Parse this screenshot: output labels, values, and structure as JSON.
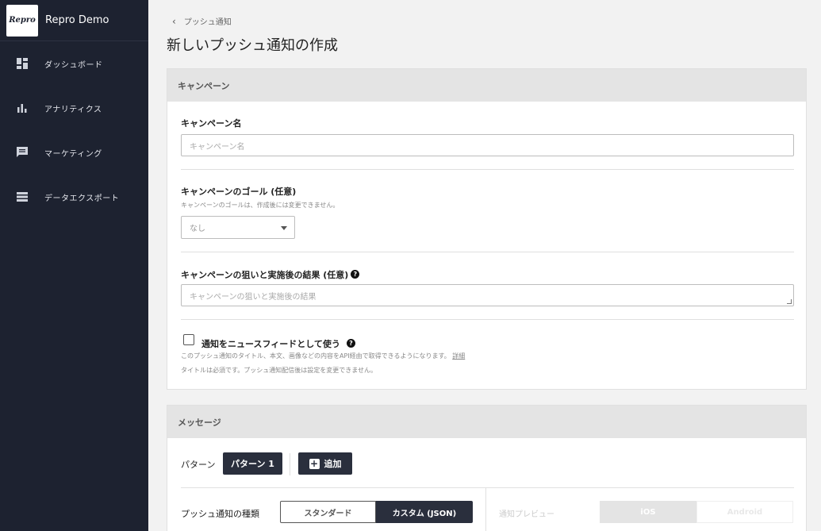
{
  "app": {
    "logo_text": "Repro",
    "name": "Repro Demo"
  },
  "sidebar": {
    "items": [
      {
        "label": "ダッシュボード",
        "icon": "dashboard-icon"
      },
      {
        "label": "アナリティクス",
        "icon": "bar-chart-icon"
      },
      {
        "label": "マーケティング",
        "icon": "message-icon"
      },
      {
        "label": "データエクスポート",
        "icon": "list-icon"
      }
    ]
  },
  "breadcrumb": {
    "label": "プッシュ通知"
  },
  "page": {
    "title": "新しいプッシュ通知の作成"
  },
  "campaign": {
    "header": "キャンペーン",
    "name_label": "キャンペーン名",
    "name_placeholder": "キャンペーン名",
    "goal_label": "キャンペーンのゴール (任意)",
    "goal_help": "キャンペーンのゴールは、作成後には変更できません。",
    "goal_value": "なし",
    "aim_label": "キャンペーンの狙いと実施後の結果 (任意)",
    "aim_placeholder": "キャンペーンの狙いと実施後の結果",
    "newsfeed_label": "通知をニュースフィードとして使う",
    "newsfeed_help1": "このプッシュ通知のタイトル、本文、画像などの内容をAPI経由で取得できるようになります。",
    "newsfeed_help_link": "詳細",
    "newsfeed_help2": "タイトルは必須です。プッシュ通知配信後は設定を変更できません。"
  },
  "message": {
    "header": "メッセージ",
    "pattern_label": "パターン",
    "pattern_tab": "パターン 1",
    "add_label": "追加",
    "type_label": "プッシュ通知の種類",
    "type_standard": "スタンダード",
    "type_custom": "カスタム (JSON)",
    "preview_label": "通知プレビュー",
    "preview_ios": "iOS",
    "preview_android": "Android"
  },
  "colors": {
    "sidebar_bg": "#1d2230",
    "dark_button": "#2a2f3d",
    "card_header": "#e4e4e4"
  }
}
